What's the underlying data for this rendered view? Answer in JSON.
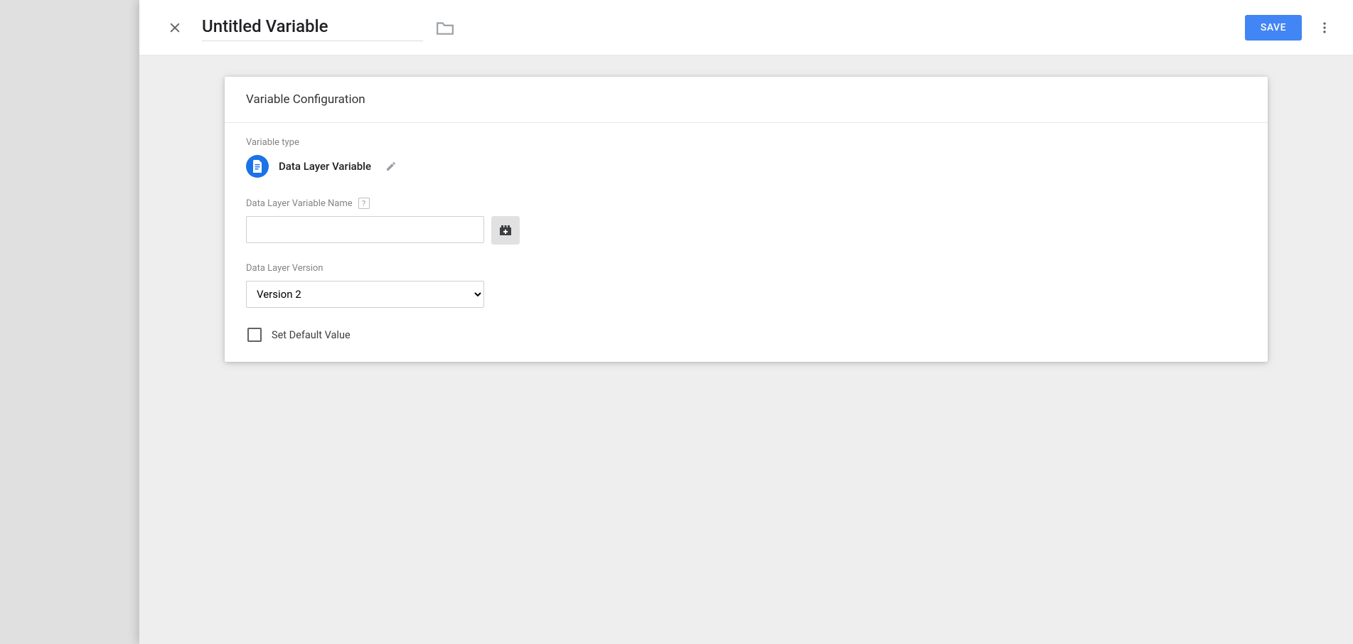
{
  "header": {
    "title": "Untitled Variable",
    "save_label": "SAVE"
  },
  "card": {
    "title": "Variable Configuration",
    "type_label": "Variable type",
    "type_name": "Data Layer Variable",
    "name_label": "Data Layer Variable Name",
    "name_value": "",
    "version_label": "Data Layer Version",
    "version_value": "Version 2",
    "default_checkbox_label": "Set Default Value"
  },
  "icons": {
    "help": "?"
  }
}
